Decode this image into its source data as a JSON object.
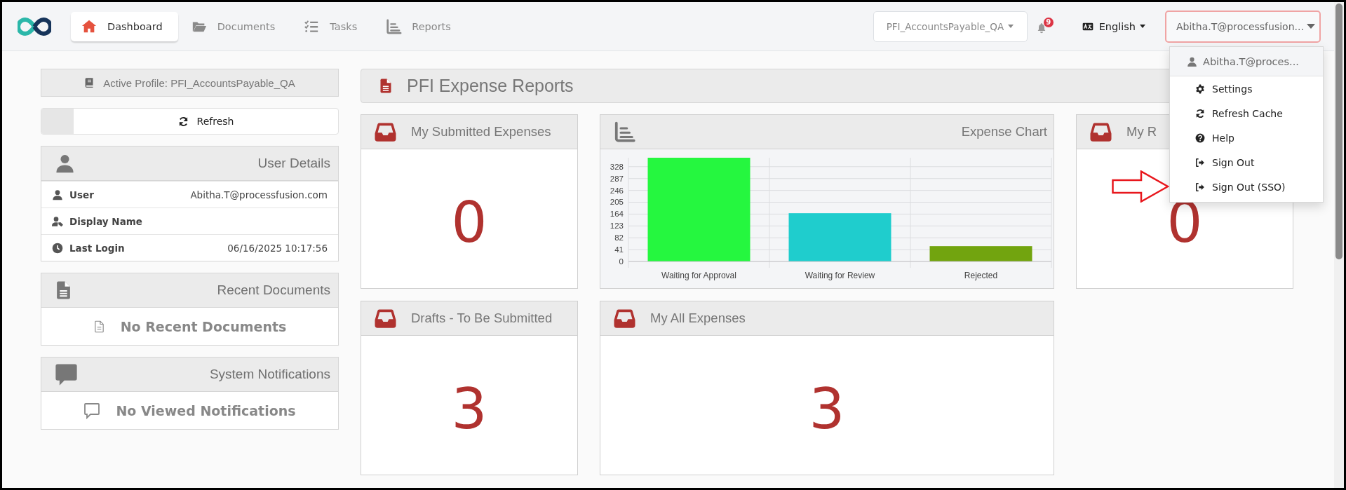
{
  "nav": {
    "tabs": [
      {
        "label": "Dashboard",
        "selected": true
      },
      {
        "label": "Documents",
        "selected": false
      },
      {
        "label": "Tasks",
        "selected": false
      },
      {
        "label": "Reports",
        "selected": false
      }
    ],
    "profile_select": "PFI_AccountsPayable_QA",
    "notification_count": "9",
    "language": "English",
    "user_button": "Abitha.T@processfusion..."
  },
  "sidebar": {
    "active_profile": "Active Profile: PFI_AccountsPayable_QA",
    "refresh_button": "Refresh",
    "user_details": {
      "title": "User Details",
      "rows": [
        {
          "label": "User",
          "value": "Abitha.T@processfusion.com"
        },
        {
          "label": "Display Name"
        },
        {
          "label": "Last Login",
          "value": "06/16/2025 10:17:56"
        }
      ]
    },
    "recent_documents": {
      "title": "Recent Documents",
      "empty_message": "No Recent Documents"
    },
    "system_notifications": {
      "title": "System Notifications",
      "empty_message": "No Viewed Notifications"
    }
  },
  "main": {
    "title": "PFI Expense Reports",
    "cards": [
      {
        "kind": "count",
        "title": "My Submitted Expenses",
        "value": "0"
      },
      {
        "kind": "chart",
        "title": "Expense Chart",
        "chart_data": {
          "type": "bar",
          "grid": true,
          "categories": [
            "Waiting for Approval",
            "Waiting for Review",
            "Rejected"
          ],
          "stacked": true,
          "ylim": [
            0,
            359
          ],
          "yticks": [
            0,
            41,
            82,
            123,
            164,
            205,
            246,
            287,
            328
          ],
          "series": [
            {
              "color": "#25f73f",
              "values": [
                359,
                null,
                null
              ]
            },
            {
              "color": "#1fcdcd",
              "values": [
                null,
                167,
                null
              ]
            },
            {
              "color": "#72a40f",
              "values": [
                null,
                null,
                53
              ]
            }
          ]
        }
      },
      {
        "kind": "count",
        "title": "My R",
        "value": "0"
      },
      {
        "kind": "count",
        "title": "Drafts - To Be Submitted",
        "value": "3"
      },
      {
        "kind": "count",
        "title": "My All Expenses",
        "value": "3"
      }
    ]
  },
  "user_menu": {
    "header": "Abitha.T@proces...",
    "items": [
      {
        "label": "Settings"
      },
      {
        "label": "Refresh Cache"
      },
      {
        "label": "Help"
      },
      {
        "label": "Sign Out"
      },
      {
        "label": "Sign Out (SSO)"
      }
    ]
  }
}
